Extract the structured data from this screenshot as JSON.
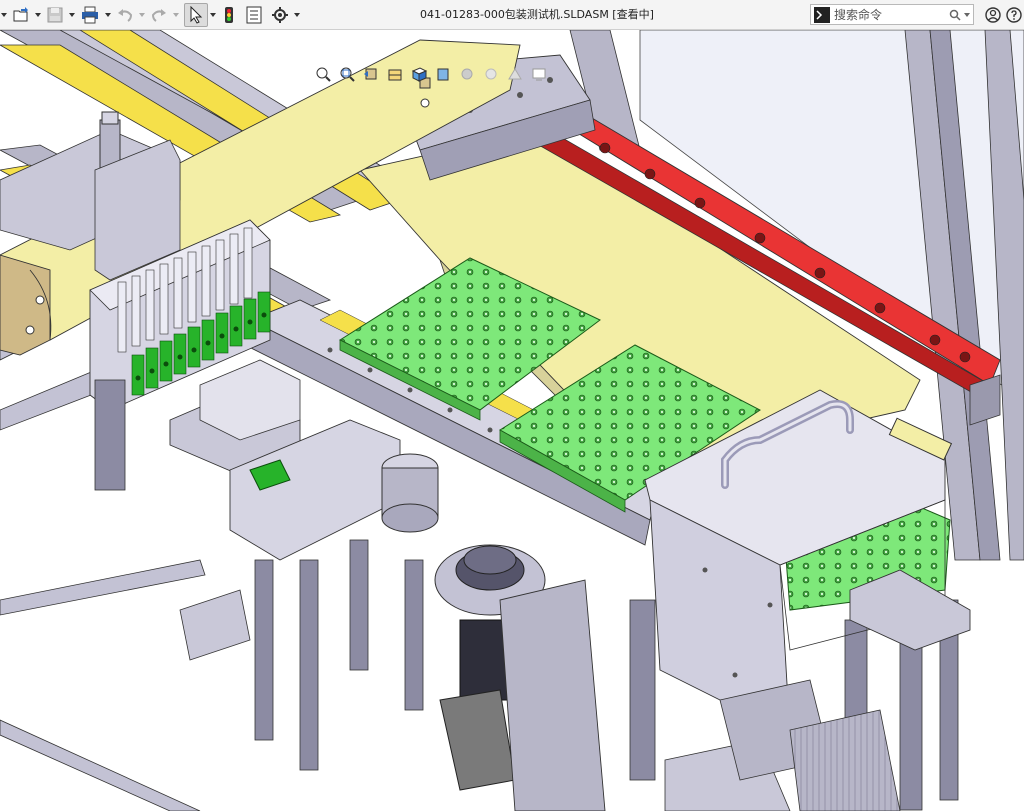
{
  "window": {
    "title": "041-01283-000包装测试机.SLDASM [查看中]"
  },
  "search": {
    "placeholder": "搜索命令"
  },
  "toolbar": {
    "icons": [
      "new-document-icon",
      "open-folder-icon",
      "save-icon",
      "print-icon",
      "undo-icon",
      "redo-icon",
      "select-arrow-icon",
      "traffic-light-icon",
      "file-properties-icon",
      "gear-icon"
    ]
  },
  "hud": {
    "icons": [
      "zoom-to-fit-icon",
      "zoom-area-icon",
      "previous-view-icon",
      "section-view-icon",
      "view-orientation-icon",
      "display-style-icon",
      "hide-show-icon",
      "edit-appearance-icon",
      "apply-scene-icon",
      "view-settings-icon"
    ]
  },
  "colors": {
    "yellow_rail": "#f5e04a",
    "cream_panel": "#f3eea6",
    "red_rail": "#e93434",
    "green_tray": "#7ee87a",
    "frame_gray": "#b7b6c8",
    "dark_post": "#8c8ba3",
    "tan_block": "#cfb987"
  }
}
